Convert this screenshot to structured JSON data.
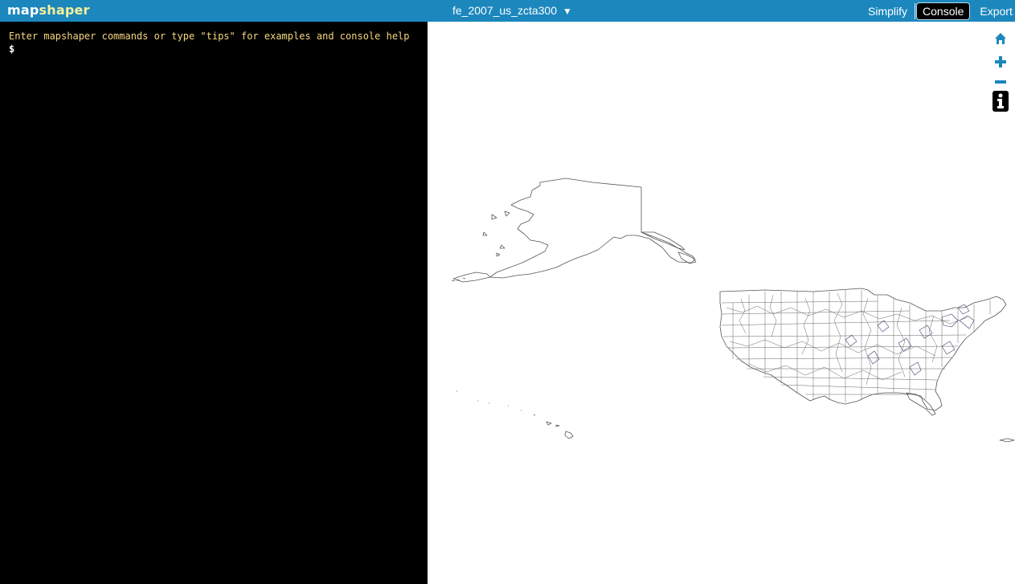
{
  "app": {
    "logo_part1": "map",
    "logo_part2": "shaper"
  },
  "layer": {
    "name": "fe_2007_us_zcta300",
    "caret": "▼"
  },
  "menu": {
    "simplify": "Simplify",
    "console": "Console",
    "export": "Export"
  },
  "console": {
    "message": "Enter mapshaper commands or type \"tips\" for examples and console help",
    "prompt": "$"
  },
  "map_tools": {
    "home": "home-icon",
    "zoom_in": "zoom-in-icon",
    "zoom_out": "zoom-out-icon",
    "info": "info-icon"
  },
  "colors": {
    "topbar": "#1b87bd",
    "logo_accent": "#f6f19a",
    "console_text": "#f6d67e",
    "tool_icon": "#1b87bd",
    "map_stroke": "#444444"
  }
}
